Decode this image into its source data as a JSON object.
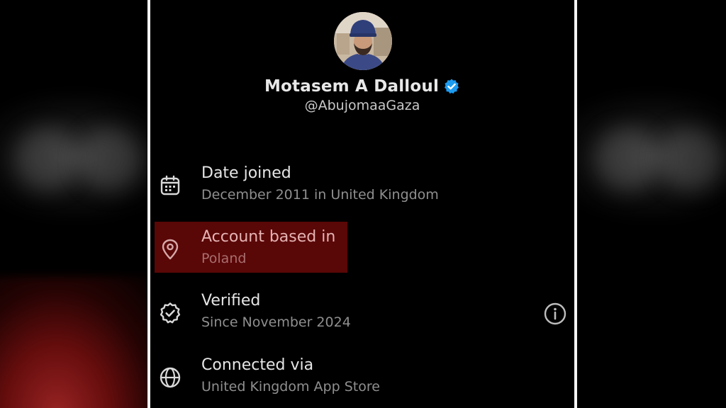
{
  "profile": {
    "name": "Motasem A Dalloul",
    "handle": "@AbujomaaGaza"
  },
  "about": {
    "items": [
      {
        "title": "Date joined",
        "subtitle": "December 2011 in United Kingdom",
        "icon": "calendar-icon"
      },
      {
        "title": "Account based in",
        "subtitle": "Poland",
        "icon": "location-pin-icon",
        "highlighted": true
      },
      {
        "title": "Verified",
        "subtitle": "Since November 2024",
        "icon": "verified-badge-icon",
        "info_icon": "info-icon"
      },
      {
        "title": "Connected via",
        "subtitle": "United Kingdom App Store",
        "icon": "globe-icon"
      }
    ]
  },
  "colors": {
    "verified_blue": "#1d9bf0",
    "highlight_red": "#5a0707",
    "background": "#000000"
  }
}
